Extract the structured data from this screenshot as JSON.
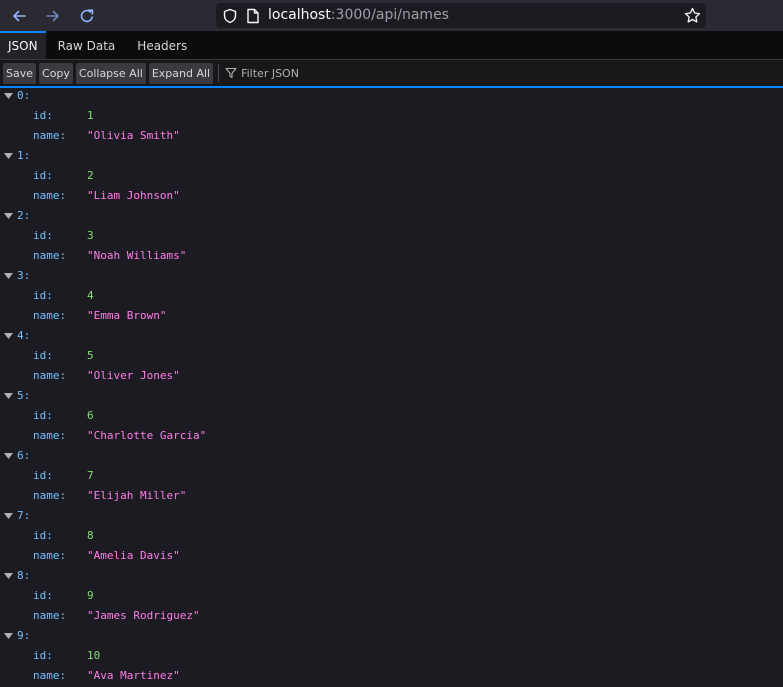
{
  "browser": {
    "url_host": "localhost",
    "url_path": ":3000/api/names"
  },
  "tabs": [
    {
      "label": "JSON",
      "selected": true
    },
    {
      "label": "Raw Data",
      "selected": false
    },
    {
      "label": "Headers",
      "selected": false
    }
  ],
  "toolbar": {
    "save_label": "Save",
    "copy_label": "Copy",
    "collapse_label": "Collapse All",
    "expand_label": "Expand All",
    "filter_placeholder": "Filter JSON"
  },
  "field_labels": {
    "id": "id:",
    "name": "name:"
  },
  "records": [
    {
      "index": "0:",
      "id": "1",
      "name": "\"Olivia Smith\""
    },
    {
      "index": "1:",
      "id": "2",
      "name": "\"Liam Johnson\""
    },
    {
      "index": "2:",
      "id": "3",
      "name": "\"Noah Williams\""
    },
    {
      "index": "3:",
      "id": "4",
      "name": "\"Emma Brown\""
    },
    {
      "index": "4:",
      "id": "5",
      "name": "\"Oliver Jones\""
    },
    {
      "index": "5:",
      "id": "6",
      "name": "\"Charlotte Garcia\""
    },
    {
      "index": "6:",
      "id": "7",
      "name": "\"Elijah Miller\""
    },
    {
      "index": "7:",
      "id": "8",
      "name": "\"Amelia Davis\""
    },
    {
      "index": "8:",
      "id": "9",
      "name": "\"James Rodriguez\""
    },
    {
      "index": "9:",
      "id": "10",
      "name": "\"Ava Martinez\""
    }
  ]
}
